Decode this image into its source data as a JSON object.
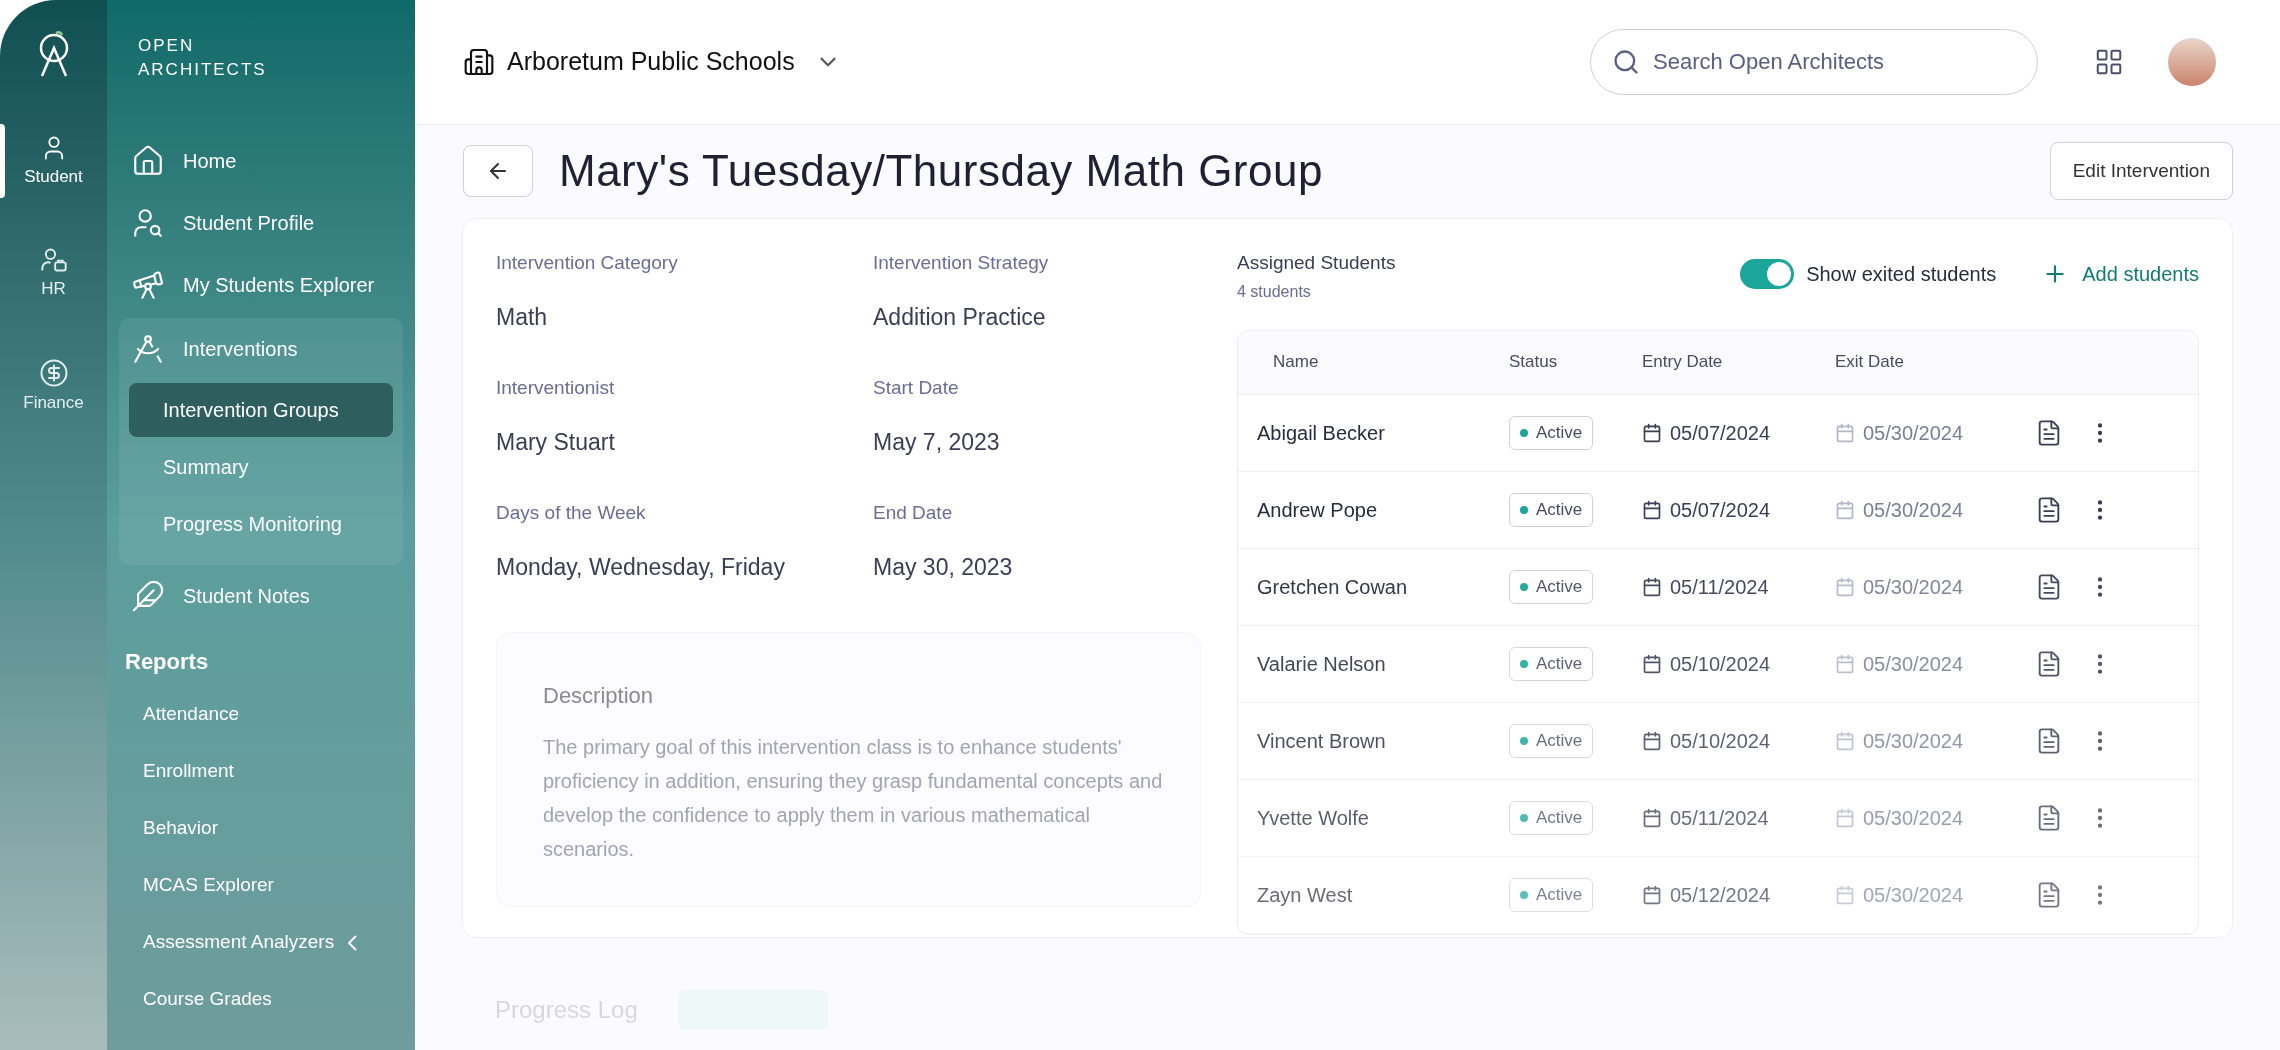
{
  "brand": {
    "name": "OPEN ARCHITECTS"
  },
  "rail": [
    {
      "label": "Student",
      "selected": true
    },
    {
      "label": "HR",
      "selected": false
    },
    {
      "label": "Finance",
      "selected": false
    }
  ],
  "nav": [
    {
      "label": "Home"
    },
    {
      "label": "Student Profile"
    },
    {
      "label": "My Students Explorer"
    },
    {
      "label": "Interventions",
      "expanded": true,
      "children": [
        {
          "label": "Intervention Groups",
          "selected": true
        },
        {
          "label": "Summary",
          "selected": false
        },
        {
          "label": "Progress Monitoring",
          "selected": false
        }
      ]
    },
    {
      "label": "Student Notes"
    }
  ],
  "reports": {
    "title": "Reports",
    "items": [
      {
        "label": "Attendance",
        "kind": "link"
      },
      {
        "label": "Enrollment",
        "kind": "link"
      },
      {
        "label": "Behavior",
        "kind": "link"
      },
      {
        "label": "MCAS Explorer",
        "kind": "link"
      },
      {
        "label": "Assessment Analyzers",
        "kind": "group"
      },
      {
        "label": "Course Grades",
        "kind": "link"
      }
    ]
  },
  "header": {
    "school": "Arboretum Public Schools",
    "search": {
      "placeholder": "Search Open Architects"
    }
  },
  "page": {
    "title": "Mary's Tuesday/Thursday Math Group",
    "edit_button": "Edit Intervention"
  },
  "details": [
    {
      "label": "Intervention Category",
      "value": "Math"
    },
    {
      "label": "Intervention Strategy",
      "value": "Addition Practice"
    },
    {
      "label": "Interventionist",
      "value": "Mary Stuart"
    },
    {
      "label": "Start Date",
      "value": "May 7, 2023"
    },
    {
      "label": "Days of the Week",
      "value": "Monday, Wednesday, Friday"
    },
    {
      "label": "End Date",
      "value": "May 30, 2023"
    }
  ],
  "description": {
    "title": "Description",
    "text": "The primary goal of this intervention class is to enhance students' proficiency in addition, ensuring they grasp fundamental concepts and develop the confidence to apply them in various mathematical scenarios."
  },
  "assigned": {
    "title": "Assigned Students",
    "count": "4 students",
    "toggle": {
      "label": "Show exited students",
      "on": true
    },
    "add_button": "Add students"
  },
  "table": {
    "columns": [
      "Name",
      "Status",
      "Entry Date",
      "Exit Date"
    ],
    "rows": [
      {
        "name": "Abigail Becker",
        "status": "Active",
        "entry": "05/07/2024",
        "exit": "05/30/2024"
      },
      {
        "name": "Andrew Pope",
        "status": "Active",
        "entry": "05/07/2024",
        "exit": "05/30/2024"
      },
      {
        "name": "Gretchen Cowan",
        "status": "Active",
        "entry": "05/11/2024",
        "exit": "05/30/2024"
      },
      {
        "name": "Valarie Nelson",
        "status": "Active",
        "entry": "05/10/2024",
        "exit": "05/30/2024"
      },
      {
        "name": "Vincent Brown",
        "status": "Active",
        "entry": "05/10/2024",
        "exit": "05/30/2024"
      },
      {
        "name": "Yvette Wolfe",
        "status": "Active",
        "entry": "05/11/2024",
        "exit": "05/30/2024"
      },
      {
        "name": "Zayn West",
        "status": "Active",
        "entry": "05/12/2024",
        "exit": "05/30/2024"
      }
    ]
  },
  "progress_log": {
    "title": "Progress Log"
  }
}
